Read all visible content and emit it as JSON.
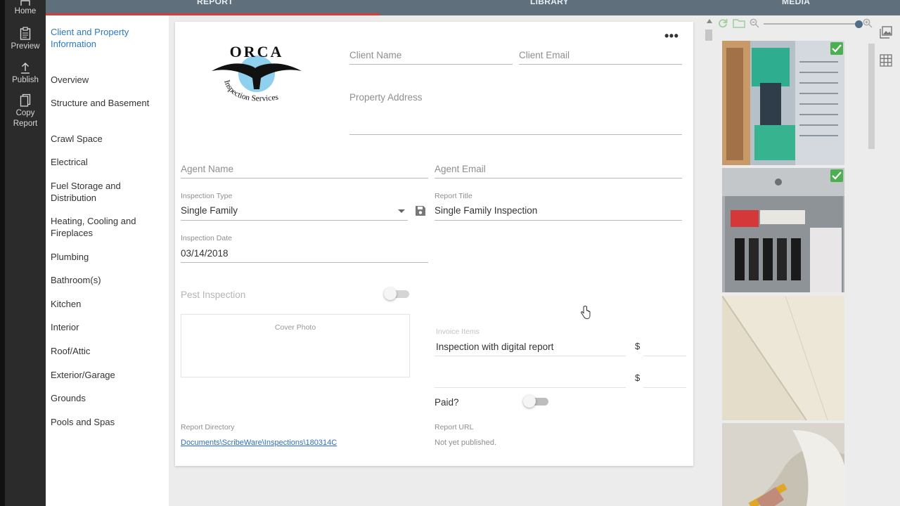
{
  "rail": {
    "items": [
      {
        "label": "Home",
        "icon": "home-icon"
      },
      {
        "label": "Preview",
        "icon": "clipboard-icon"
      },
      {
        "label": "Publish",
        "icon": "upload-icon"
      },
      {
        "label": "Copy Report",
        "icon": "copy-icon"
      }
    ]
  },
  "tabs": [
    "REPORT",
    "LIBRARY",
    "MEDIA"
  ],
  "nav": {
    "items": [
      "Client and Property Information",
      "Overview",
      "Structure and Basement",
      "Crawl Space",
      "Electrical",
      "Fuel Storage and Distribution",
      "Heating, Cooling and Fireplaces",
      "Plumbing",
      "Bathroom(s)",
      "Kitchen",
      "Interior",
      "Roof/Attic",
      "Exterior/Garage",
      "Grounds",
      "Pools and Spas"
    ]
  },
  "logo": {
    "top_text": "ORCA",
    "arc_text": "Inspection Services"
  },
  "form": {
    "client_name_placeholder": "Client Name",
    "client_email_placeholder": "Client Email",
    "property_address_placeholder": "Property Address",
    "agent_name_placeholder": "Agent Name",
    "agent_email_placeholder": "Agent Email",
    "inspection_type_label": "Inspection Type",
    "inspection_type_value": "Single Family",
    "report_title_label": "Report Title",
    "report_title_value": "Single Family Inspection",
    "inspection_date_label": "Inspection Date",
    "inspection_date_value": "03/14/2018",
    "pest_inspection_label": "Pest Inspection",
    "cover_photo_label": "Cover Photo",
    "invoice_items_label": "Invoice Items",
    "invoice_item_1": "Inspection with digital report",
    "currency": "$",
    "paid_label": "Paid?",
    "report_directory_label": "Report Directory",
    "report_directory_value": "Documents\\ScribeWare\\Inspections\\180314C",
    "report_url_label": "Report URL",
    "report_url_value": "Not yet published."
  },
  "colors": {
    "accent": "#2c79c5",
    "tab_underline": "#d83b3b",
    "check": "#4caf50"
  },
  "media": {
    "photos": [
      {
        "subject": "electrical-label-photo",
        "checked": true
      },
      {
        "subject": "breaker-panel-photo",
        "checked": true
      },
      {
        "subject": "ceiling-corner-photo",
        "checked": false
      },
      {
        "subject": "thermometer-photo",
        "checked": false
      }
    ]
  }
}
